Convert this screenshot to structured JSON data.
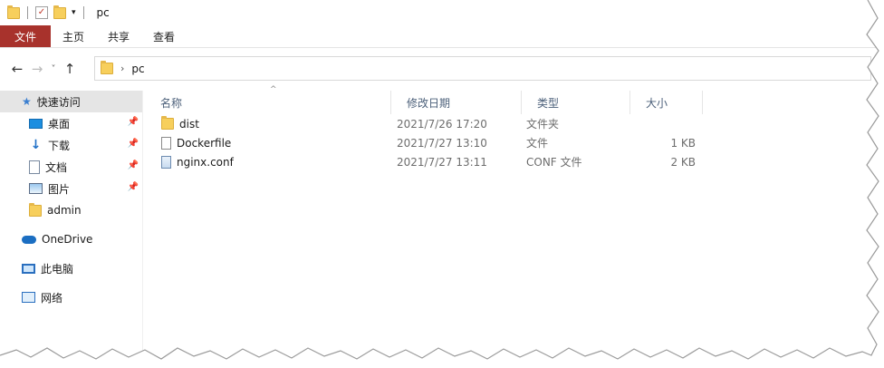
{
  "title": "pc",
  "ribbon": {
    "tabs": [
      "文件",
      "主页",
      "共享",
      "查看"
    ]
  },
  "address": {
    "path": [
      "pc"
    ]
  },
  "sidebar": {
    "quick_access": "快速访问",
    "pinned": [
      {
        "label": "桌面",
        "icon": "desktop-icon"
      },
      {
        "label": "下载",
        "icon": "download-icon"
      },
      {
        "label": "文档",
        "icon": "documents-icon"
      },
      {
        "label": "图片",
        "icon": "pictures-icon"
      },
      {
        "label": "admin",
        "icon": "folder-icon"
      }
    ],
    "onedrive": "OneDrive",
    "this_pc": "此电脑",
    "network": "网络"
  },
  "columns": {
    "name": "名称",
    "date": "修改日期",
    "type": "类型",
    "size": "大小"
  },
  "files": [
    {
      "name": "dist",
      "date": "2021/7/26 17:20",
      "type": "文件夹",
      "size": "",
      "icon": "folder-icon"
    },
    {
      "name": "Dockerfile",
      "date": "2021/7/27 13:10",
      "type": "文件",
      "size": "1 KB",
      "icon": "file-icon"
    },
    {
      "name": "nginx.conf",
      "date": "2021/7/27 13:11",
      "type": "CONF 文件",
      "size": "2 KB",
      "icon": "conf-file-icon"
    }
  ],
  "colors": {
    "file_tab": "#a8322c",
    "selection": "#e5e5e5",
    "header_text": "#4c607a"
  }
}
